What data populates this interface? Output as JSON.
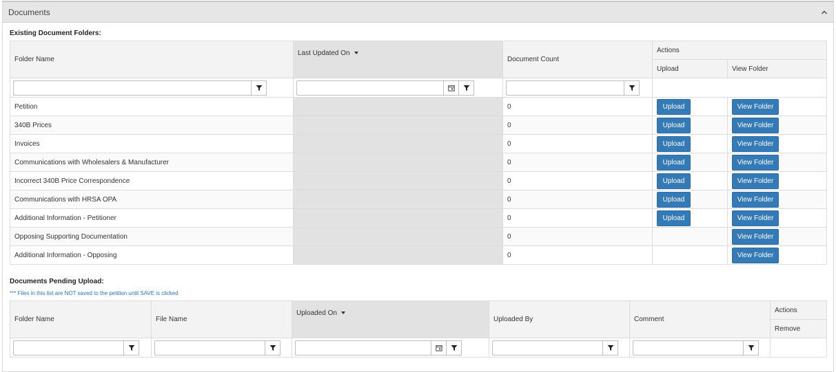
{
  "panel": {
    "title": "Documents"
  },
  "existing": {
    "section_label": "Existing Document Folders:",
    "headers": {
      "folder_name": "Folder Name",
      "last_updated_on": "Last Updated On",
      "document_count": "Document Count",
      "actions": "Actions",
      "upload": "Upload",
      "view_folder": "View Folder"
    },
    "rows": [
      {
        "folder": "Petition",
        "count": "0",
        "upload": "Upload",
        "view": "View Folder"
      },
      {
        "folder": "340B Prices",
        "count": "0",
        "upload": "Upload",
        "view": "View Folder"
      },
      {
        "folder": "Invoices",
        "count": "0",
        "upload": "Upload",
        "view": "View Folder"
      },
      {
        "folder": "Communications with Wholesalers & Manufacturer",
        "count": "0",
        "upload": "Upload",
        "view": "View Folder"
      },
      {
        "folder": "Incorrect 340B Price Correspondence",
        "count": "0",
        "upload": "Upload",
        "view": "View Folder"
      },
      {
        "folder": "Communications with HRSA OPA",
        "count": "0",
        "upload": "Upload",
        "view": "View Folder"
      },
      {
        "folder": "Additional Information - Petitioner",
        "count": "0",
        "upload": "Upload",
        "view": "View Folder"
      },
      {
        "folder": "Opposing Supporting Documentation",
        "count": "0",
        "upload": "",
        "view": "View Folder"
      },
      {
        "folder": "Additional Information - Opposing",
        "count": "0",
        "upload": "",
        "view": "View Folder"
      }
    ]
  },
  "pending": {
    "section_label": "Documents Pending Upload:",
    "note": "*** Files in this list are NOT saved to the petition until SAVE is clicked",
    "headers": {
      "folder_name": "Folder Name",
      "file_name": "File Name",
      "uploaded_on": "Uploaded On",
      "uploaded_by": "Uploaded By",
      "comment": "Comment",
      "actions": "Actions",
      "remove": "Remove"
    }
  },
  "icons": {
    "collapse": "chevron-up-icon",
    "filter": "filter-icon",
    "calendar": "calendar-icon",
    "sort": "sort-desc-icon"
  },
  "colors": {
    "primary_button": "#337ab7",
    "note_text": "#2a73c4",
    "sorted_column": "#e2e2e2"
  }
}
